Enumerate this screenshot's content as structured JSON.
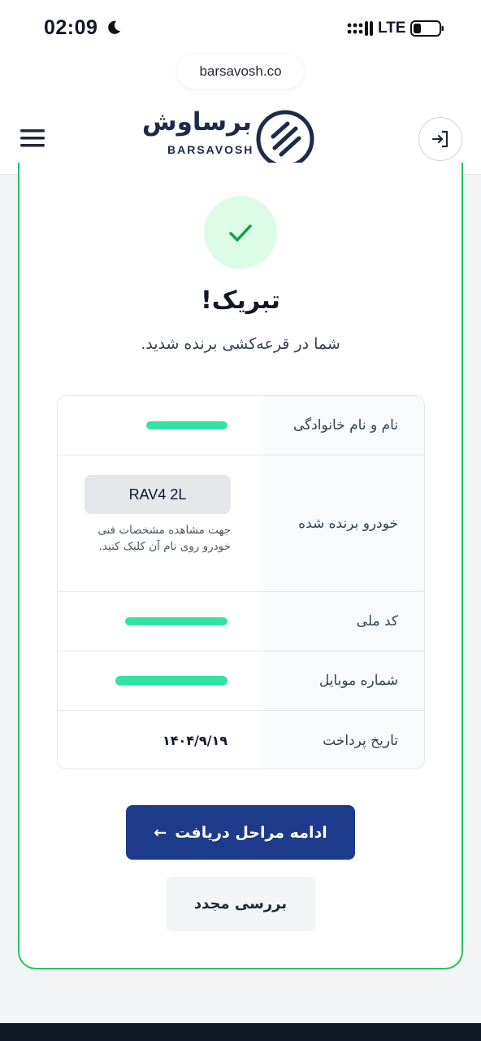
{
  "status_bar": {
    "time": "02:09",
    "network": "LTE"
  },
  "browser": {
    "url": "barsavosh.co"
  },
  "header": {
    "logo_fa": "برساوش",
    "logo_en": "BARSAVOSH"
  },
  "result": {
    "title": "تبریک!",
    "subtitle": "شما در قرعه‌کشی برنده شدید."
  },
  "info": {
    "rows": [
      {
        "label": "نام و نام خانوادگی",
        "value": ""
      },
      {
        "label": "خودرو برنده شده",
        "value": "RAV4 2L",
        "hint": "جهت مشاهده مشخصات فنی خودرو روی نام آن کلیک کنید."
      },
      {
        "label": "کد ملی",
        "value": ""
      },
      {
        "label": "شماره موبایل",
        "value": ""
      },
      {
        "label": "تاریخ پرداخت",
        "value": "۱۴۰۴/۹/۱۹"
      }
    ]
  },
  "actions": {
    "continue_label": "ادامه مراحل دریافت",
    "continue_arrow": "←",
    "recheck_label": "بررسی مجدد"
  },
  "colors": {
    "primary": "#1e3a8a",
    "success": "#22c55e",
    "redaction": "#34e3a4"
  }
}
